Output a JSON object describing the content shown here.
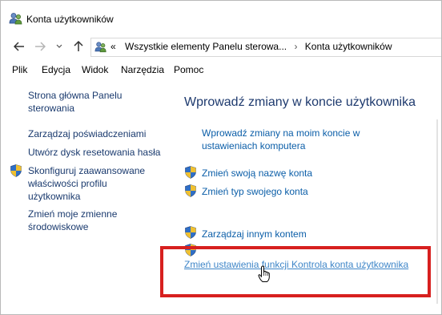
{
  "window": {
    "title": "Konta użytkowników"
  },
  "address": {
    "overflow": "«",
    "crumbs": [
      "Wszystkie elementy Panelu sterowa...",
      "Konta użytkowników"
    ],
    "separator": "›"
  },
  "menu": [
    "Plik",
    "Edycja",
    "Widok",
    "Narzędzia",
    "Pomoc"
  ],
  "sidebar": {
    "items": [
      {
        "label_lines": [
          "Strona główna Panelu",
          "sterowania"
        ],
        "shield": false
      },
      {
        "label_lines": [
          "Zarządzaj poświadczeniami"
        ],
        "shield": false
      },
      {
        "label_lines": [
          "Utwórz dysk resetowania hasła"
        ],
        "shield": false
      },
      {
        "label_lines": [
          "Skonfiguruj zaawansowane",
          "właściwości profilu",
          "użytkownika"
        ],
        "shield": true
      },
      {
        "label_lines": [
          "Zmień moje zmienne",
          "środowiskowe"
        ],
        "shield": false
      }
    ]
  },
  "main": {
    "title": "Wprowadź zmiany w koncie użytkownika",
    "links": [
      {
        "label_lines": [
          "Wprowadź zmiany na moim koncie w",
          "ustawieniach komputera"
        ],
        "shield": false
      },
      {
        "label_lines": [
          "Zmień swoją nazwę konta"
        ],
        "shield": true
      },
      {
        "label_lines": [
          "Zmień typ swojego konta"
        ],
        "shield": true
      },
      {
        "label_lines": [
          "Zarządzaj innym kontem"
        ],
        "shield": true
      },
      {
        "label_lines": [
          "Zmień ustawienia funkcji Kontrola konta użytkownika"
        ],
        "shield": true
      }
    ]
  },
  "colors": {
    "link": "#0b5ea8",
    "highlight": "#d7201f",
    "title": "#1e3a6e"
  }
}
